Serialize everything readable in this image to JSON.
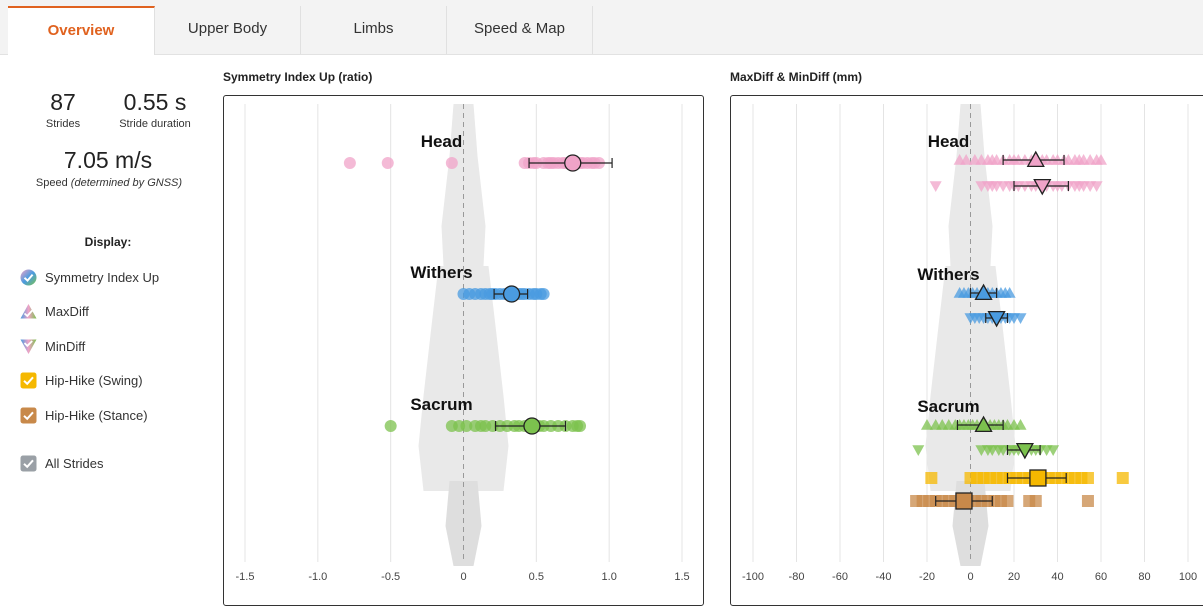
{
  "tabs": [
    {
      "label": "Overview",
      "active": true
    },
    {
      "label": "Upper Body",
      "active": false
    },
    {
      "label": "Limbs",
      "active": false
    },
    {
      "label": "Speed & Map",
      "active": false
    }
  ],
  "stats": {
    "strides_value": "87",
    "strides_label": "Strides",
    "stride_duration_value": "0.55 s",
    "stride_duration_label": "Stride duration",
    "speed_value": "7.05 m/s",
    "speed_label_plain": "Speed ",
    "speed_label_italic": "(determined by GNSS)"
  },
  "display": {
    "title": "Display:",
    "items": [
      {
        "label": "Symmetry Index Up",
        "icon": "symmetry-index-icon",
        "checked": true
      },
      {
        "label": "MaxDiff",
        "icon": "maxdiff-icon",
        "checked": true
      },
      {
        "label": "MinDiff",
        "icon": "mindiff-icon",
        "checked": true
      },
      {
        "label": "Hip-Hike (Swing)",
        "icon": "checkbox-yellow-icon",
        "checked": true,
        "color": "#f5b800"
      },
      {
        "label": "Hip-Hike (Stance)",
        "icon": "checkbox-brown-icon",
        "checked": true,
        "color": "#c8894a"
      },
      {
        "label": "All Strides",
        "icon": "checkbox-gray-icon",
        "checked": true,
        "color": "#9aa0a6"
      }
    ]
  },
  "colors": {
    "accent": "#e0621f",
    "head": "#f0a3c8",
    "withers": "#4a9be0",
    "sacrum": "#7cc24e",
    "hip_swing": "#f5b800",
    "hip_stance": "#c8894a"
  },
  "chart_data": [
    {
      "type": "scatter",
      "title": "Symmetry Index Up (ratio)",
      "xlim": [
        -1.5,
        1.5
      ],
      "x_ticks": [
        -1.5,
        -1.0,
        -0.5,
        0,
        0.5,
        1.0,
        1.5
      ],
      "x_tick_labels": [
        "-1.5",
        "-1.0",
        "-0.5",
        "0",
        "0.5",
        "1.0",
        "1.5"
      ],
      "grid": true,
      "zero_line": "dashed",
      "groups": [
        {
          "label": "Head",
          "color": "#f0a3c8",
          "rows": [
            {
              "marker": "circle",
              "mean": 0.75,
              "err": [
                0.45,
                1.02
              ],
              "points": [
                -0.78,
                -0.52,
                -0.08,
                0.42,
                0.45,
                0.48,
                0.5,
                0.55,
                0.58,
                0.6,
                0.62,
                0.65,
                0.68,
                0.7,
                0.72,
                0.75,
                0.78,
                0.8,
                0.82,
                0.85,
                0.88,
                0.9,
                0.93
              ]
            }
          ]
        },
        {
          "label": "Withers",
          "color": "#4a9be0",
          "rows": [
            {
              "marker": "circle",
              "mean": 0.33,
              "err": [
                0.21,
                0.44
              ],
              "points": [
                0.0,
                0.04,
                0.08,
                0.12,
                0.15,
                0.18,
                0.2,
                0.22,
                0.25,
                0.28,
                0.3,
                0.33,
                0.35,
                0.38,
                0.4,
                0.42,
                0.45,
                0.48,
                0.5,
                0.53,
                0.55
              ]
            }
          ]
        },
        {
          "label": "Sacrum",
          "color": "#7cc24e",
          "rows": [
            {
              "marker": "circle",
              "mean": 0.47,
              "err": [
                0.22,
                0.7
              ],
              "points": [
                -0.5,
                -0.08,
                -0.03,
                0.02,
                0.08,
                0.12,
                0.15,
                0.2,
                0.25,
                0.3,
                0.35,
                0.38,
                0.42,
                0.45,
                0.48,
                0.52,
                0.55,
                0.6,
                0.65,
                0.7,
                0.75,
                0.78,
                0.8
              ]
            }
          ]
        }
      ]
    },
    {
      "type": "scatter",
      "title": "MaxDiff & MinDiff (mm)",
      "xlim": [
        -100,
        100
      ],
      "x_ticks": [
        -100,
        -80,
        -60,
        -40,
        -20,
        0,
        20,
        40,
        60,
        80,
        100
      ],
      "x_tick_labels": [
        "-100",
        "-80",
        "-60",
        "-40",
        "-20",
        "0",
        "20",
        "40",
        "60",
        "80",
        "100"
      ],
      "grid": true,
      "zero_line": "dashed",
      "groups": [
        {
          "label": "Head",
          "color": "#f0a3c8",
          "rows": [
            {
              "marker": "triangle-up",
              "mean": 30,
              "err": [
                15,
                43
              ],
              "points": [
                -5,
                -2,
                2,
                5,
                8,
                10,
                12,
                15,
                18,
                20,
                22,
                25,
                28,
                30,
                33,
                35,
                38,
                40,
                43,
                45,
                48,
                50,
                52,
                55,
                58,
                60
              ]
            },
            {
              "marker": "triangle-down",
              "mean": 33,
              "err": [
                20,
                45
              ],
              "points": [
                -16,
                5,
                8,
                10,
                12,
                15,
                18,
                20,
                22,
                25,
                28,
                30,
                33,
                35,
                38,
                40,
                42,
                45,
                48,
                50,
                52,
                55,
                58
              ]
            }
          ]
        },
        {
          "label": "Withers",
          "color": "#4a9be0",
          "rows": [
            {
              "marker": "triangle-up",
              "mean": 6,
              "err": [
                0,
                12
              ],
              "points": [
                -5,
                -3,
                -1,
                1,
                3,
                5,
                6,
                8,
                10,
                12,
                14,
                16,
                18
              ]
            },
            {
              "marker": "triangle-down",
              "mean": 12,
              "err": [
                7,
                17
              ],
              "points": [
                0,
                2,
                4,
                6,
                8,
                10,
                12,
                14,
                16,
                18,
                20,
                23
              ]
            }
          ]
        },
        {
          "label": "Sacrum",
          "color": "#7cc24e",
          "rows": [
            {
              "marker": "triangle-up",
              "mean": 6,
              "err": [
                -6,
                15
              ],
              "points": [
                -20,
                -16,
                -13,
                -10,
                -7,
                -5,
                -3,
                -1,
                1,
                3,
                5,
                7,
                9,
                11,
                13,
                15,
                17,
                20,
                23
              ]
            },
            {
              "marker": "triangle-down",
              "mean": 25,
              "err": [
                17,
                32
              ],
              "points": [
                -24,
                5,
                8,
                10,
                13,
                15,
                18,
                20,
                22,
                25,
                28,
                30,
                32,
                35,
                38
              ]
            }
          ]
        },
        {
          "label": "",
          "color": "#f5b800",
          "rows": [
            {
              "marker": "square",
              "mean": 31,
              "err": [
                17,
                44
              ],
              "points": [
                -18,
                0,
                3,
                6,
                9,
                12,
                15,
                18,
                21,
                24,
                27,
                30,
                33,
                36,
                39,
                42,
                45,
                48,
                51,
                54,
                70
              ]
            }
          ]
        },
        {
          "label": "",
          "color": "#c8894a",
          "rows": [
            {
              "marker": "square",
              "mean": -3,
              "err": [
                -16,
                10
              ],
              "points": [
                -25,
                -22,
                -19,
                -16,
                -13,
                -10,
                -7,
                -4,
                -1,
                2,
                5,
                8,
                11,
                14,
                17,
                27,
                30,
                54
              ]
            }
          ]
        }
      ]
    }
  ]
}
